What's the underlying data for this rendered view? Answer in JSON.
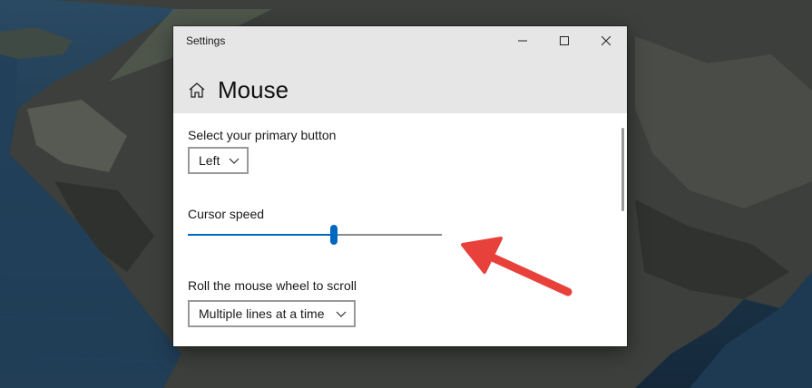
{
  "window": {
    "app_title": "Settings",
    "page_title": "Mouse"
  },
  "primary_button": {
    "label": "Select your primary button",
    "value": "Left"
  },
  "cursor_speed": {
    "label": "Cursor speed",
    "value_fraction": 0.575
  },
  "scroll_wheel": {
    "label": "Roll the mouse wheel to scroll",
    "value": "Multiple lines at a time"
  },
  "colors": {
    "accent": "#0067c0",
    "annotation_arrow": "#e8413b",
    "titlebar": "#e6e6e6"
  },
  "icons": {
    "home": "home-icon",
    "minimize": "minimize-icon",
    "maximize": "maximize-icon",
    "close": "close-icon",
    "dropdown": "chevron-down-icon"
  }
}
